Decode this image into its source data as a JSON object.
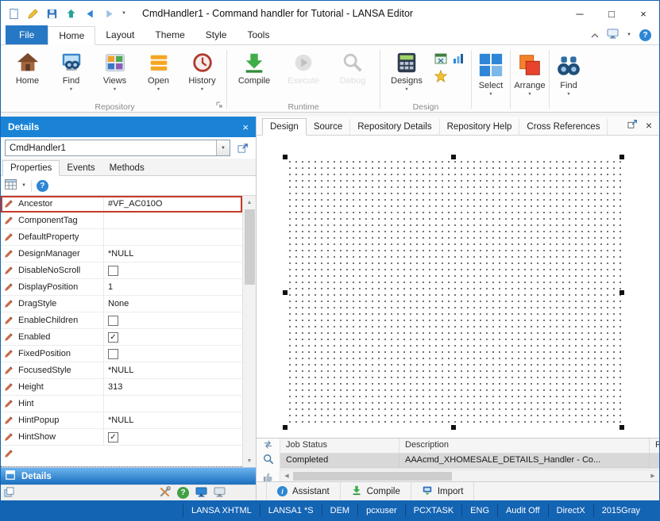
{
  "colors": {
    "accent_blue": "#1a83d6",
    "file_blue": "#2778c4",
    "statusbar_blue": "#1464b4",
    "highlight_red": "#c43b2a"
  },
  "titlebar": {
    "title": "CmdHandler1 - Command handler for Tutorial - LANSA Editor"
  },
  "ribbon": {
    "file_tab": "File",
    "tabs": [
      "Home",
      "Layout",
      "Theme",
      "Style",
      "Tools"
    ],
    "repository": {
      "label": "Repository",
      "home": "Home",
      "find": "Find",
      "views": "Views",
      "open": "Open",
      "history": "History"
    },
    "runtime": {
      "label": "Runtime",
      "compile": "Compile",
      "execute": "Execute",
      "debug": "Debug"
    },
    "design": {
      "label": "Design",
      "designs": "Designs"
    },
    "select_label": "Select",
    "arrange_label": "Arrange",
    "find_label": "Find"
  },
  "details": {
    "title": "Details",
    "object_name": "CmdHandler1",
    "tabs": {
      "properties": "Properties",
      "events": "Events",
      "methods": "Methods"
    },
    "properties": [
      {
        "name": "Ancestor",
        "value": "#VF_AC010O",
        "selected": true
      },
      {
        "name": "ComponentTag",
        "value": ""
      },
      {
        "name": "DefaultProperty",
        "value": ""
      },
      {
        "name": "DesignManager",
        "value": "*NULL"
      },
      {
        "name": "DisableNoScroll",
        "is_checkbox": true,
        "checked": false
      },
      {
        "name": "DisplayPosition",
        "value": "1"
      },
      {
        "name": "DragStyle",
        "value": "None"
      },
      {
        "name": "EnableChildren",
        "is_checkbox": true,
        "checked": false
      },
      {
        "name": "Enabled",
        "is_checkbox": true,
        "checked": true
      },
      {
        "name": "FixedPosition",
        "is_checkbox": true,
        "checked": false
      },
      {
        "name": "FocusedStyle",
        "value": "*NULL"
      },
      {
        "name": "Height",
        "value": "313"
      },
      {
        "name": "Hint",
        "value": ""
      },
      {
        "name": "HintPopup",
        "value": "*NULL"
      },
      {
        "name": "HintShow",
        "is_checkbox": true,
        "checked": true
      }
    ],
    "footer": "Details"
  },
  "workspace": {
    "tabs": [
      "Design",
      "Source",
      "Repository Details",
      "Repository Help",
      "Cross References"
    ]
  },
  "jobs": {
    "columns": [
      "Job Status",
      "Description",
      "Resu"
    ],
    "rows": [
      {
        "status": "Completed",
        "description": "AAAcmd_XHOMESALE_DETAILS_Handler - Co..."
      }
    ]
  },
  "bottom_bar": {
    "assistant": "Assistant",
    "compile": "Compile",
    "import": "Import"
  },
  "statusbar": {
    "items": [
      "LANSA XHTML",
      "LANSA1 *S",
      "DEM",
      "pcxuser",
      "PCXTASK",
      "ENG",
      "Audit Off",
      "DirectX",
      "2015Gray"
    ]
  }
}
